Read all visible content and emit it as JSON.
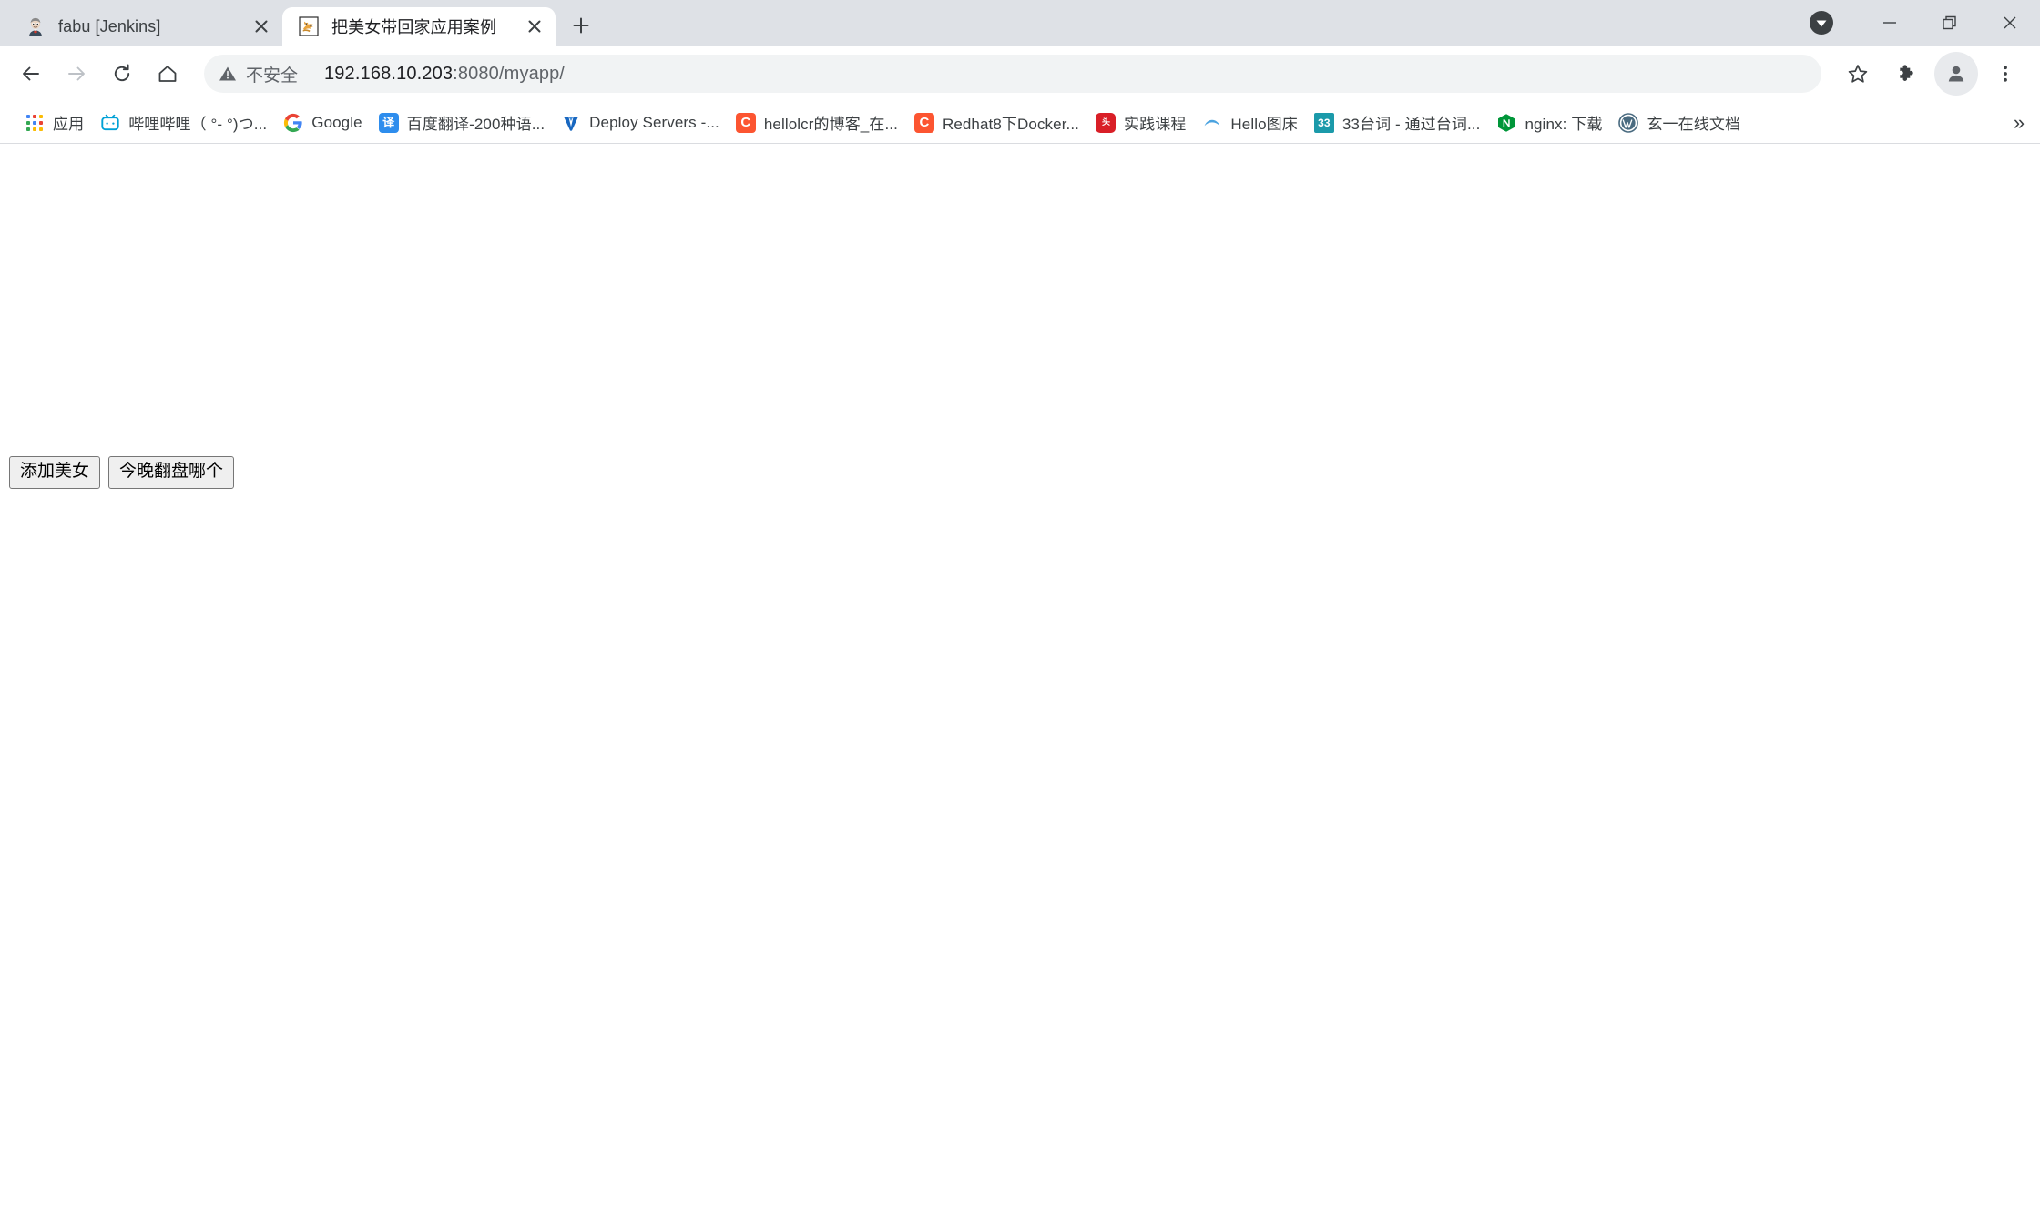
{
  "window": {
    "download_indicator": "download-arrow",
    "controls": {
      "minimize": "minimize",
      "maximize": "maximize-restore",
      "close": "close"
    }
  },
  "tabs": [
    {
      "title": "fabu [Jenkins]",
      "favicon": "jenkins-butler-icon",
      "active": false,
      "close_label": "×"
    },
    {
      "title": "把美女带回家应用案例",
      "favicon": "tomcat-cat-icon",
      "active": true,
      "close_label": "×"
    }
  ],
  "new_tab_label": "+",
  "toolbar": {
    "back": "back-arrow",
    "forward": "forward-arrow",
    "reload": "reload",
    "home": "home",
    "bookmark_star": "star",
    "extensions": "puzzle-piece",
    "profile": "avatar",
    "menu": "three-dot-menu"
  },
  "omnibox": {
    "security_icon": "warning-triangle",
    "security_text": "不安全",
    "url_host": "192.168.10.203",
    "url_rest": ":8080/myapp/",
    "full_url": "192.168.10.203:8080/myapp/"
  },
  "bookmarks": {
    "items": [
      {
        "label": "应用",
        "icon": "apps-grid-icon",
        "icon_kind": "grid",
        "color": "#4285f4"
      },
      {
        "label": "哔哩哔哩（ °- °)つ...",
        "icon": "bilibili-icon",
        "icon_kind": "bilibili",
        "color": "#00a1d6"
      },
      {
        "label": "Google",
        "icon": "google-g-icon",
        "icon_kind": "google",
        "color": "#4285f4"
      },
      {
        "label": "百度翻译-200种语...",
        "icon": "baidu-fanyi-icon",
        "icon_kind": "square",
        "color": "#2e8ded",
        "glyph": "译"
      },
      {
        "label": "Deploy Servers -...",
        "icon": "vuetify-v-icon",
        "icon_kind": "vee",
        "color": "#1867c0"
      },
      {
        "label": "hellolcr的博客_在...",
        "icon": "csdn-c-icon",
        "icon_kind": "square",
        "color": "#fc5531",
        "glyph": "C"
      },
      {
        "label": "Redhat8下Docker...",
        "icon": "csdn-c-icon",
        "icon_kind": "square",
        "color": "#fc5531",
        "glyph": "C"
      },
      {
        "label": "实践课程",
        "icon": "educoder-icon",
        "icon_kind": "educoder",
        "color": "#d91f27",
        "glyph": "头"
      },
      {
        "label": "Hello图床",
        "icon": "cloud-icon",
        "icon_kind": "cloud",
        "color": "#4aa3e0"
      },
      {
        "label": "33台词 - 通过台词...",
        "icon": "taici-33-icon",
        "icon_kind": "square",
        "color": "#1b9aaa",
        "glyph": "33"
      },
      {
        "label": "nginx: 下载",
        "icon": "nginx-n-icon",
        "icon_kind": "nginx",
        "color": "#009639",
        "glyph": "N"
      },
      {
        "label": "玄一在线文档",
        "icon": "wordpress-icon",
        "icon_kind": "wordpress",
        "color": "#21759b"
      }
    ],
    "overflow_label": "»"
  },
  "page": {
    "buttons": [
      {
        "label": "添加美女"
      },
      {
        "label": "今晚翻盘哪个"
      }
    ]
  },
  "colors": {
    "tabstrip_bg": "#dee1e6",
    "toolbar_bg": "#ffffff",
    "omnibox_bg": "#f1f3f4",
    "text_primary": "#202124",
    "text_secondary": "#5f6368",
    "divider": "#dadce0"
  }
}
